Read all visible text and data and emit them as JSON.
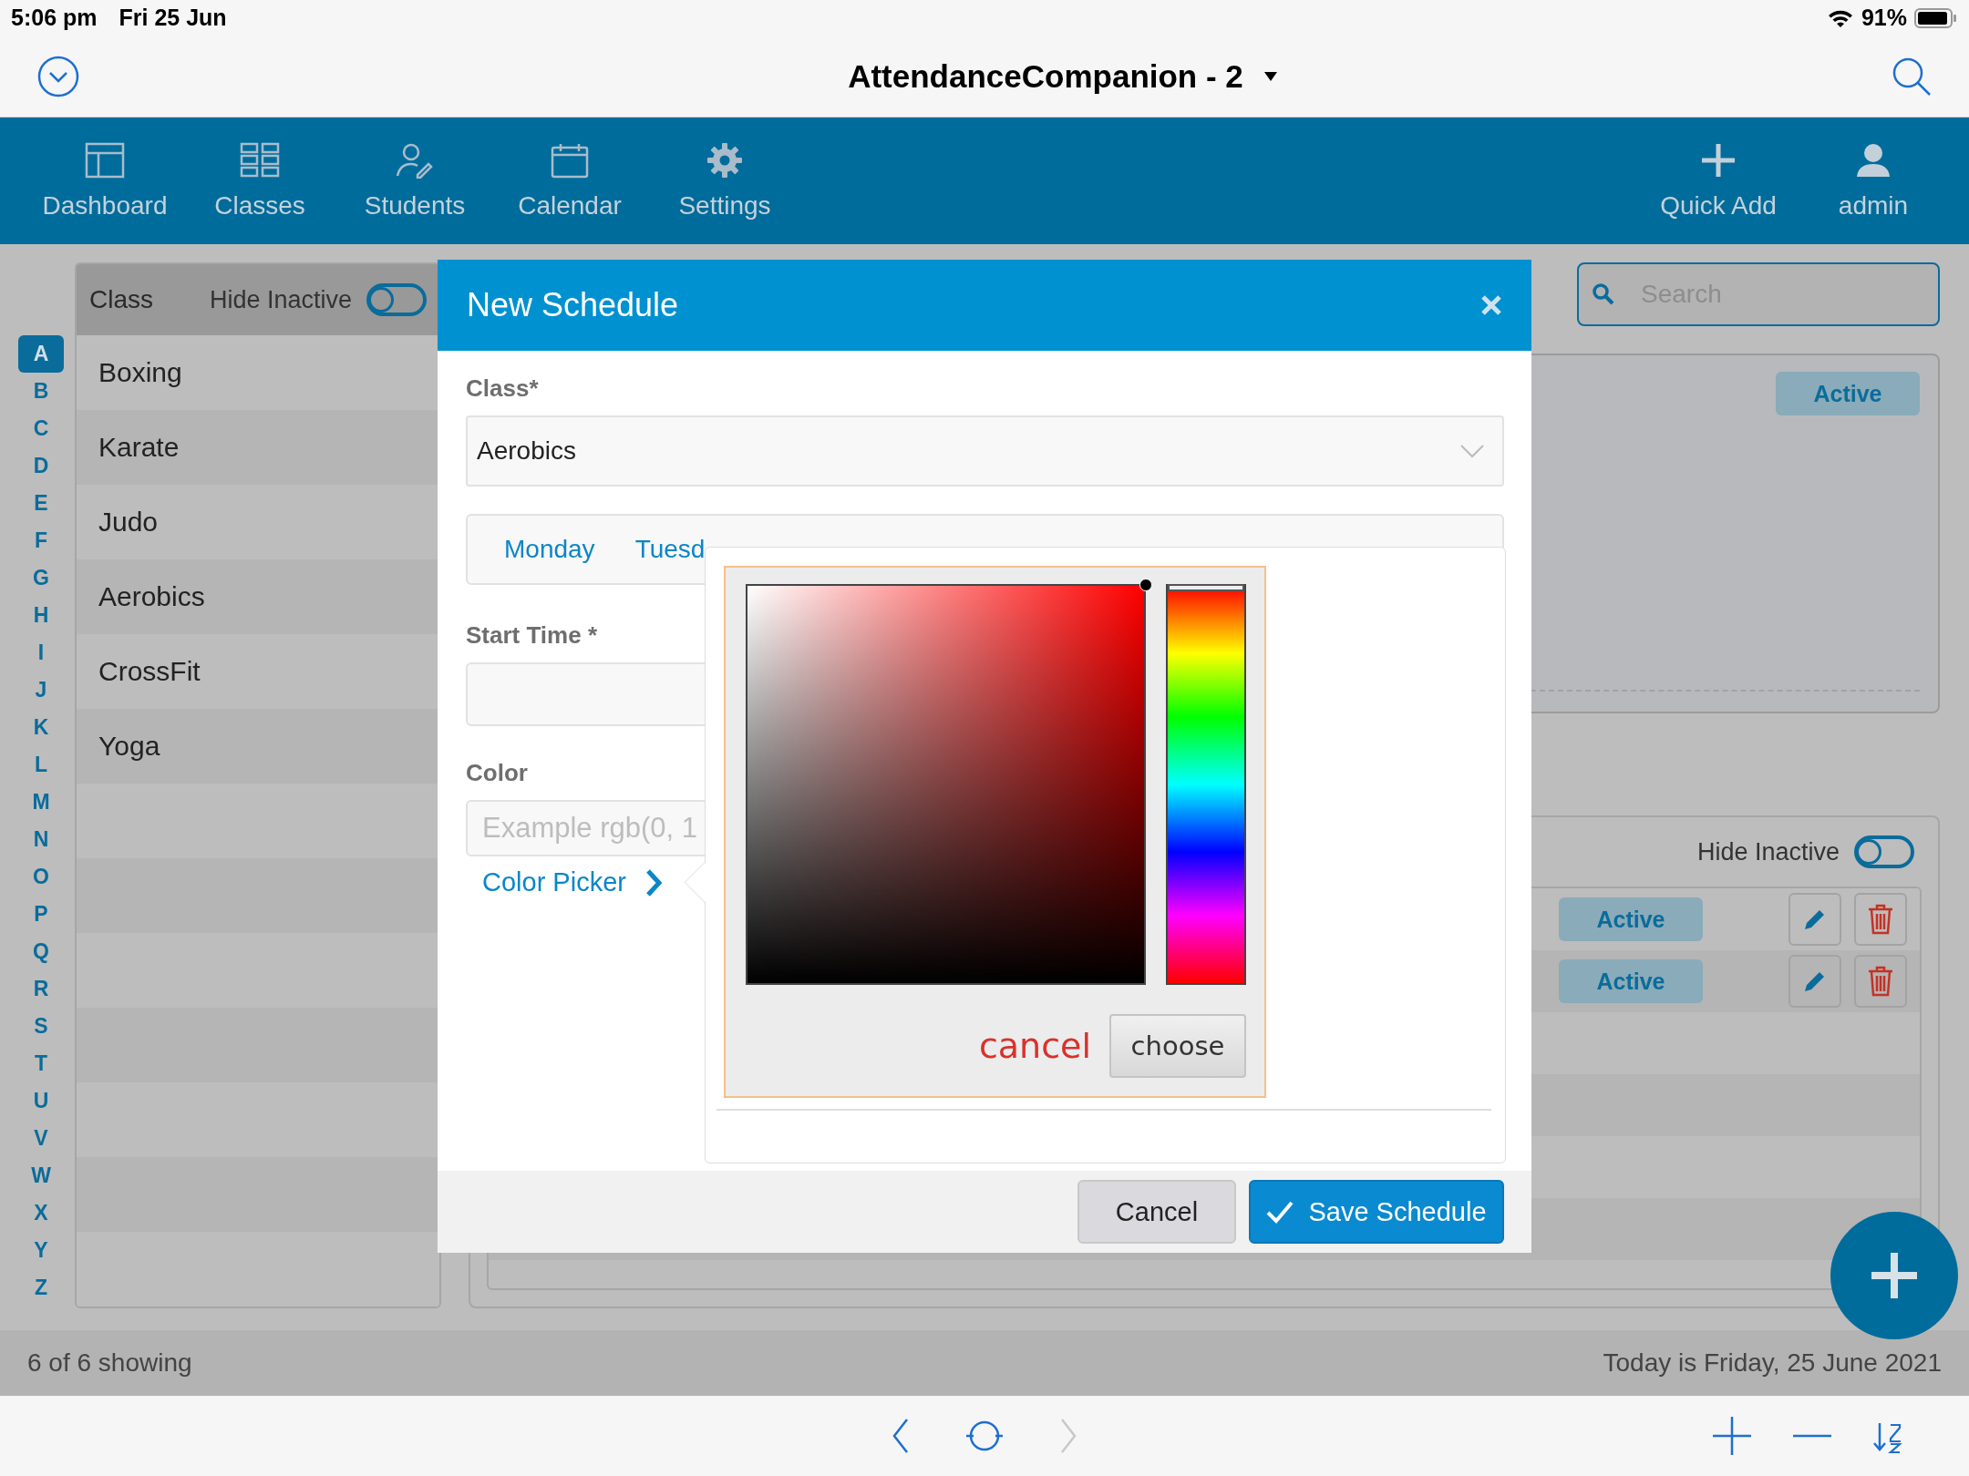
{
  "status_bar": {
    "time": "5:06 pm",
    "date": "Fri 25 Jun",
    "battery": "91%"
  },
  "header": {
    "title": "AttendanceCompanion - 2"
  },
  "nav": {
    "items": [
      {
        "label": "Dashboard"
      },
      {
        "label": "Classes"
      },
      {
        "label": "Students"
      },
      {
        "label": "Calendar"
      },
      {
        "label": "Settings"
      }
    ],
    "right_items": [
      {
        "label": "Quick Add"
      },
      {
        "label": "admin"
      }
    ]
  },
  "class_list": {
    "header": "Class",
    "hide_inactive_label": "Hide Inactive",
    "hide_inactive_on": false,
    "letters": [
      {
        "letter": "A",
        "selected": true
      },
      {
        "letter": "B",
        "selected": false
      },
      {
        "letter": "C",
        "selected": false
      },
      {
        "letter": "D",
        "selected": false
      },
      {
        "letter": "E",
        "selected": false
      },
      {
        "letter": "F",
        "selected": false
      },
      {
        "letter": "G",
        "selected": false
      },
      {
        "letter": "H",
        "selected": false
      },
      {
        "letter": "I",
        "selected": false
      },
      {
        "letter": "J",
        "selected": false
      },
      {
        "letter": "K",
        "selected": false
      },
      {
        "letter": "L",
        "selected": false
      },
      {
        "letter": "M",
        "selected": false
      },
      {
        "letter": "N",
        "selected": false
      },
      {
        "letter": "O",
        "selected": false
      },
      {
        "letter": "P",
        "selected": false
      },
      {
        "letter": "Q",
        "selected": false
      },
      {
        "letter": "R",
        "selected": false
      },
      {
        "letter": "S",
        "selected": false
      },
      {
        "letter": "T",
        "selected": false
      },
      {
        "letter": "U",
        "selected": false
      },
      {
        "letter": "V",
        "selected": false
      },
      {
        "letter": "W",
        "selected": false
      },
      {
        "letter": "X",
        "selected": false
      },
      {
        "letter": "Y",
        "selected": false
      },
      {
        "letter": "Z",
        "selected": false
      }
    ],
    "items": [
      "Boxing",
      "Karate",
      "Judo",
      "Aerobics",
      "CrossFit",
      "Yoga"
    ]
  },
  "search": {
    "placeholder": "Search"
  },
  "schedule_card": {
    "status": "Active"
  },
  "schedule_table": {
    "hide_inactive_label": "Hide Inactive",
    "hide_inactive_on": false,
    "rows": [
      {
        "status": "Active"
      },
      {
        "status": "Active"
      }
    ]
  },
  "footer": {
    "count": "6 of 6 showing",
    "today": "Today is Friday, 25 June 2021"
  },
  "modal": {
    "title": "New Schedule",
    "class_label": "Class*",
    "class_value": "Aerobics",
    "days": [
      "Monday",
      "Tuesd"
    ],
    "start_time_label": "Start Time *",
    "color_label": "Color",
    "color_placeholder": "Example rgb(0, 1",
    "color_picker_link": "Color Picker",
    "cancel": "Cancel",
    "save": "Save Schedule"
  },
  "color_picker": {
    "hue_slider": {
      "level": 0
    },
    "cancel": "cancel",
    "choose": "choose"
  }
}
